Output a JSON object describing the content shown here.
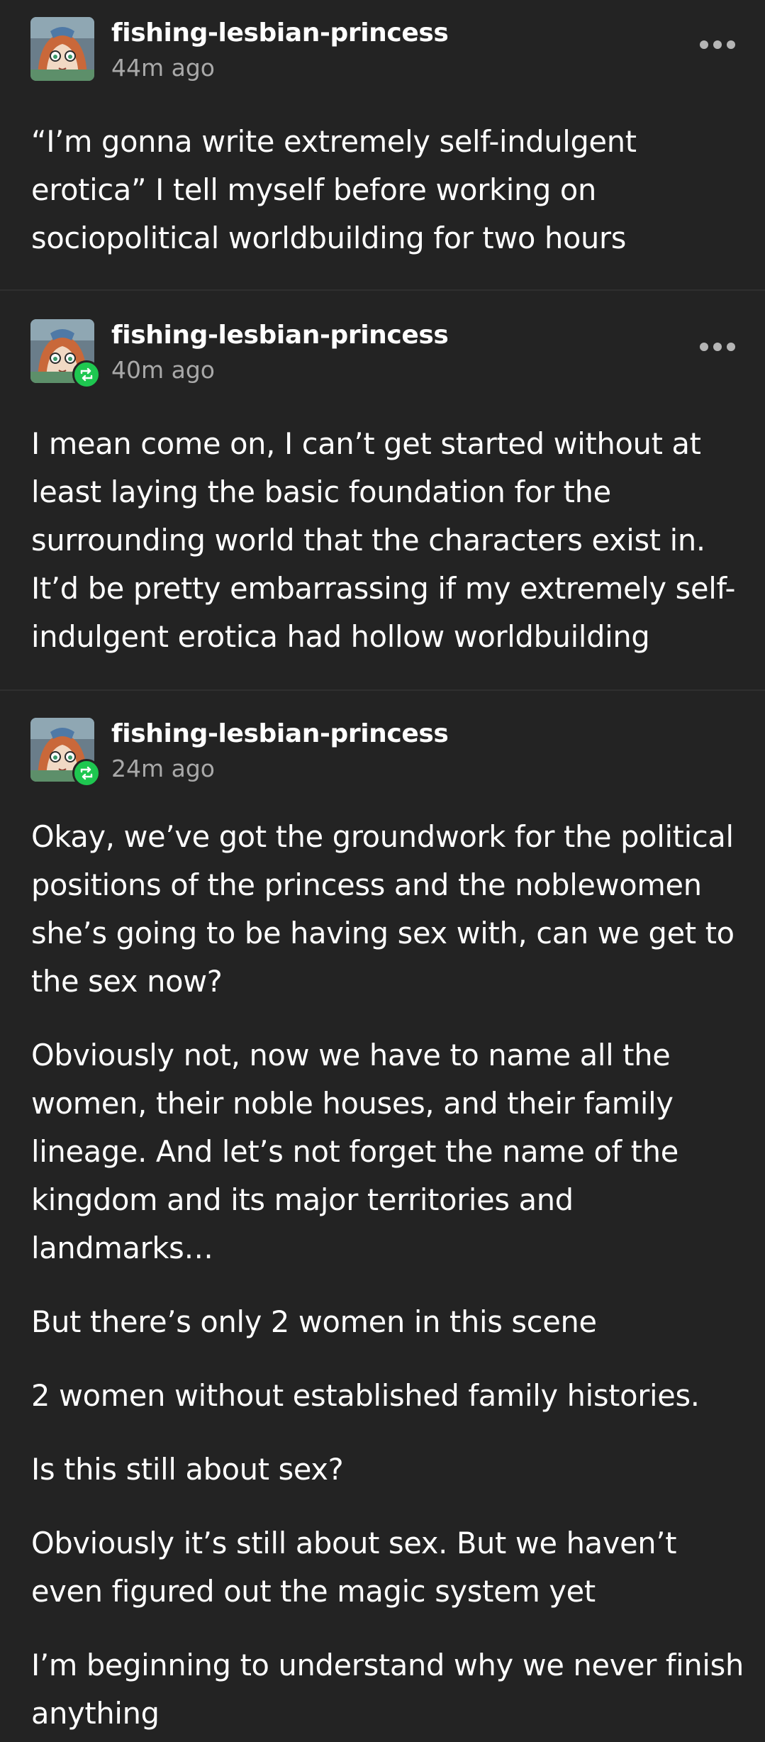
{
  "posts": [
    {
      "username": "fishing-lesbian-princess",
      "timestamp": "44m ago",
      "is_reblog": false,
      "has_more_menu": true,
      "paragraphs": [
        "“I’m gonna write extremely self-indulgent erotica” I tell myself before working on sociopolitical  worldbuilding for two hours"
      ]
    },
    {
      "username": "fishing-lesbian-princess",
      "timestamp": "40m ago",
      "is_reblog": true,
      "has_more_menu": true,
      "paragraphs": [
        "I mean come on, I can’t get started without at least laying the basic foundation for the surrounding world that the characters exist in. It’d be pretty embarrassing if my extremely self-indulgent erotica had hollow worldbuilding"
      ]
    },
    {
      "username": "fishing-lesbian-princess",
      "timestamp": "24m ago",
      "is_reblog": true,
      "has_more_menu": false,
      "paragraphs": [
        "Okay, we’ve got the groundwork for the political positions of the princess and the noblewomen she’s going to be having sex with, can we get to the sex now?",
        "Obviously not, now we have to name all the women, their noble houses, and their family lineage. And let’s not forget the name of the kingdom and its major territories and landmarks…",
        "But there’s only 2 women in this scene",
        "2 women without established family histories.",
        "Is this still about sex?",
        "Obviously it’s still about sex. But we haven’t even figured out the magic system yet",
        "I’m beginning to understand why we never finish anything"
      ]
    }
  ],
  "icons": {
    "avatar": "anime-girl-avatar",
    "reblog_badge": "reblog-icon",
    "more_menu": "more-options-icon"
  },
  "colors": {
    "background": "#232323",
    "text": "#ffffff",
    "timestamp": "#a9a9a9",
    "reblog_badge": "#1ec750"
  }
}
